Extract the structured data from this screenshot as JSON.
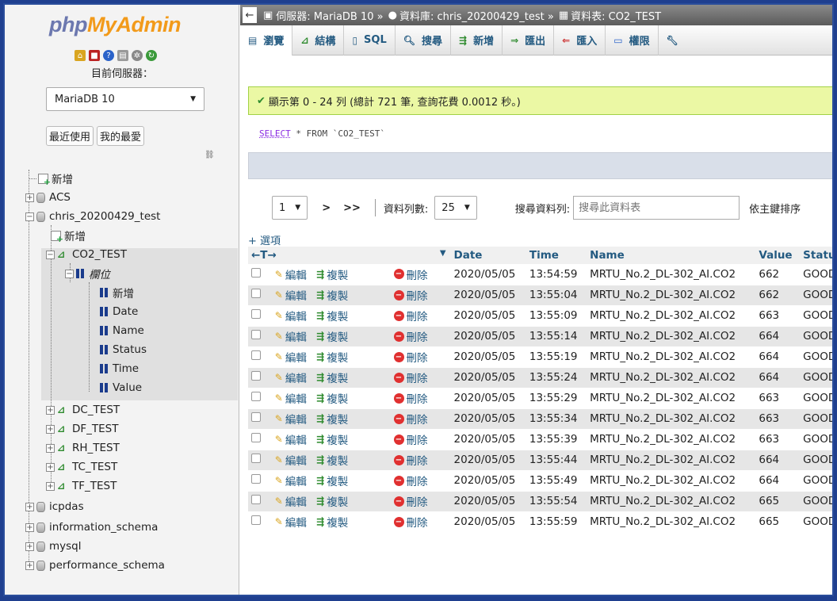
{
  "logo": {
    "part1": "php",
    "part2": "MyAdmin"
  },
  "sidebar": {
    "server_label": "目前伺服器：",
    "server_value": "MariaDB 10",
    "recent_tab": "最近使用",
    "favorites_tab": "我的最愛",
    "tree": {
      "new": "新增",
      "db_acs": "ACS",
      "db_chris": "chris_20200429_test",
      "chris_new": "新增",
      "tbl_co2": "CO2_TEST",
      "columns_label": "欄位",
      "col_new": "新增",
      "col_date": "Date",
      "col_name": "Name",
      "col_status": "Status",
      "col_time": "Time",
      "col_value": "Value",
      "tbl_dc": "DC_TEST",
      "tbl_df": "DF_TEST",
      "tbl_rh": "RH_TEST",
      "tbl_tc": "TC_TEST",
      "tbl_tf": "TF_TEST",
      "db_icpdas": "icpdas",
      "db_info": "information_schema",
      "db_mysql": "mysql",
      "db_perf": "performance_schema"
    }
  },
  "breadcrumb": {
    "server": "伺服器: MariaDB 10 »",
    "db": "資料庫: chris_20200429_test »",
    "table": "資料表: CO2_TEST"
  },
  "menu": {
    "browse": "瀏覽",
    "structure": "結構",
    "sql": "SQL",
    "search": "搜尋",
    "insert": "新增",
    "export": "匯出",
    "import": "匯入",
    "privileges": "權限"
  },
  "message": "顯示第 0 - 24 列 (總計 721 筆, 查詢花費 0.0012 秒。)",
  "sql": {
    "kw": "SELECT",
    "rest": " * FROM `CO2_TEST`"
  },
  "nav": {
    "page": "1",
    "next": ">",
    "last": ">>",
    "rows_label": "資料列數:",
    "rows_value": "25",
    "search_label": "搜尋資料列:",
    "search_placeholder": "搜尋此資料表",
    "sort_label": "依主鍵排序"
  },
  "options_label": "+ 選項",
  "table": {
    "arrows": "←T→",
    "sort_caret": "▼",
    "headers": [
      "Date",
      "Time",
      "Name",
      "Value",
      "Status"
    ],
    "action_labels": {
      "edit": "編輯",
      "copy": "複製",
      "delete": "刪除"
    },
    "rows": [
      [
        "2020/05/05",
        "13:54:59",
        "MRTU_No.2_DL-302_AI.CO2",
        "662",
        "GOOD"
      ],
      [
        "2020/05/05",
        "13:55:04",
        "MRTU_No.2_DL-302_AI.CO2",
        "662",
        "GOOD"
      ],
      [
        "2020/05/05",
        "13:55:09",
        "MRTU_No.2_DL-302_AI.CO2",
        "663",
        "GOOD"
      ],
      [
        "2020/05/05",
        "13:55:14",
        "MRTU_No.2_DL-302_AI.CO2",
        "664",
        "GOOD"
      ],
      [
        "2020/05/05",
        "13:55:19",
        "MRTU_No.2_DL-302_AI.CO2",
        "664",
        "GOOD"
      ],
      [
        "2020/05/05",
        "13:55:24",
        "MRTU_No.2_DL-302_AI.CO2",
        "664",
        "GOOD"
      ],
      [
        "2020/05/05",
        "13:55:29",
        "MRTU_No.2_DL-302_AI.CO2",
        "663",
        "GOOD"
      ],
      [
        "2020/05/05",
        "13:55:34",
        "MRTU_No.2_DL-302_AI.CO2",
        "663",
        "GOOD"
      ],
      [
        "2020/05/05",
        "13:55:39",
        "MRTU_No.2_DL-302_AI.CO2",
        "663",
        "GOOD"
      ],
      [
        "2020/05/05",
        "13:55:44",
        "MRTU_No.2_DL-302_AI.CO2",
        "664",
        "GOOD"
      ],
      [
        "2020/05/05",
        "13:55:49",
        "MRTU_No.2_DL-302_AI.CO2",
        "664",
        "GOOD"
      ],
      [
        "2020/05/05",
        "13:55:54",
        "MRTU_No.2_DL-302_AI.CO2",
        "665",
        "GOOD"
      ],
      [
        "2020/05/05",
        "13:55:59",
        "MRTU_No.2_DL-302_AI.CO2",
        "665",
        "GOOD"
      ]
    ]
  }
}
